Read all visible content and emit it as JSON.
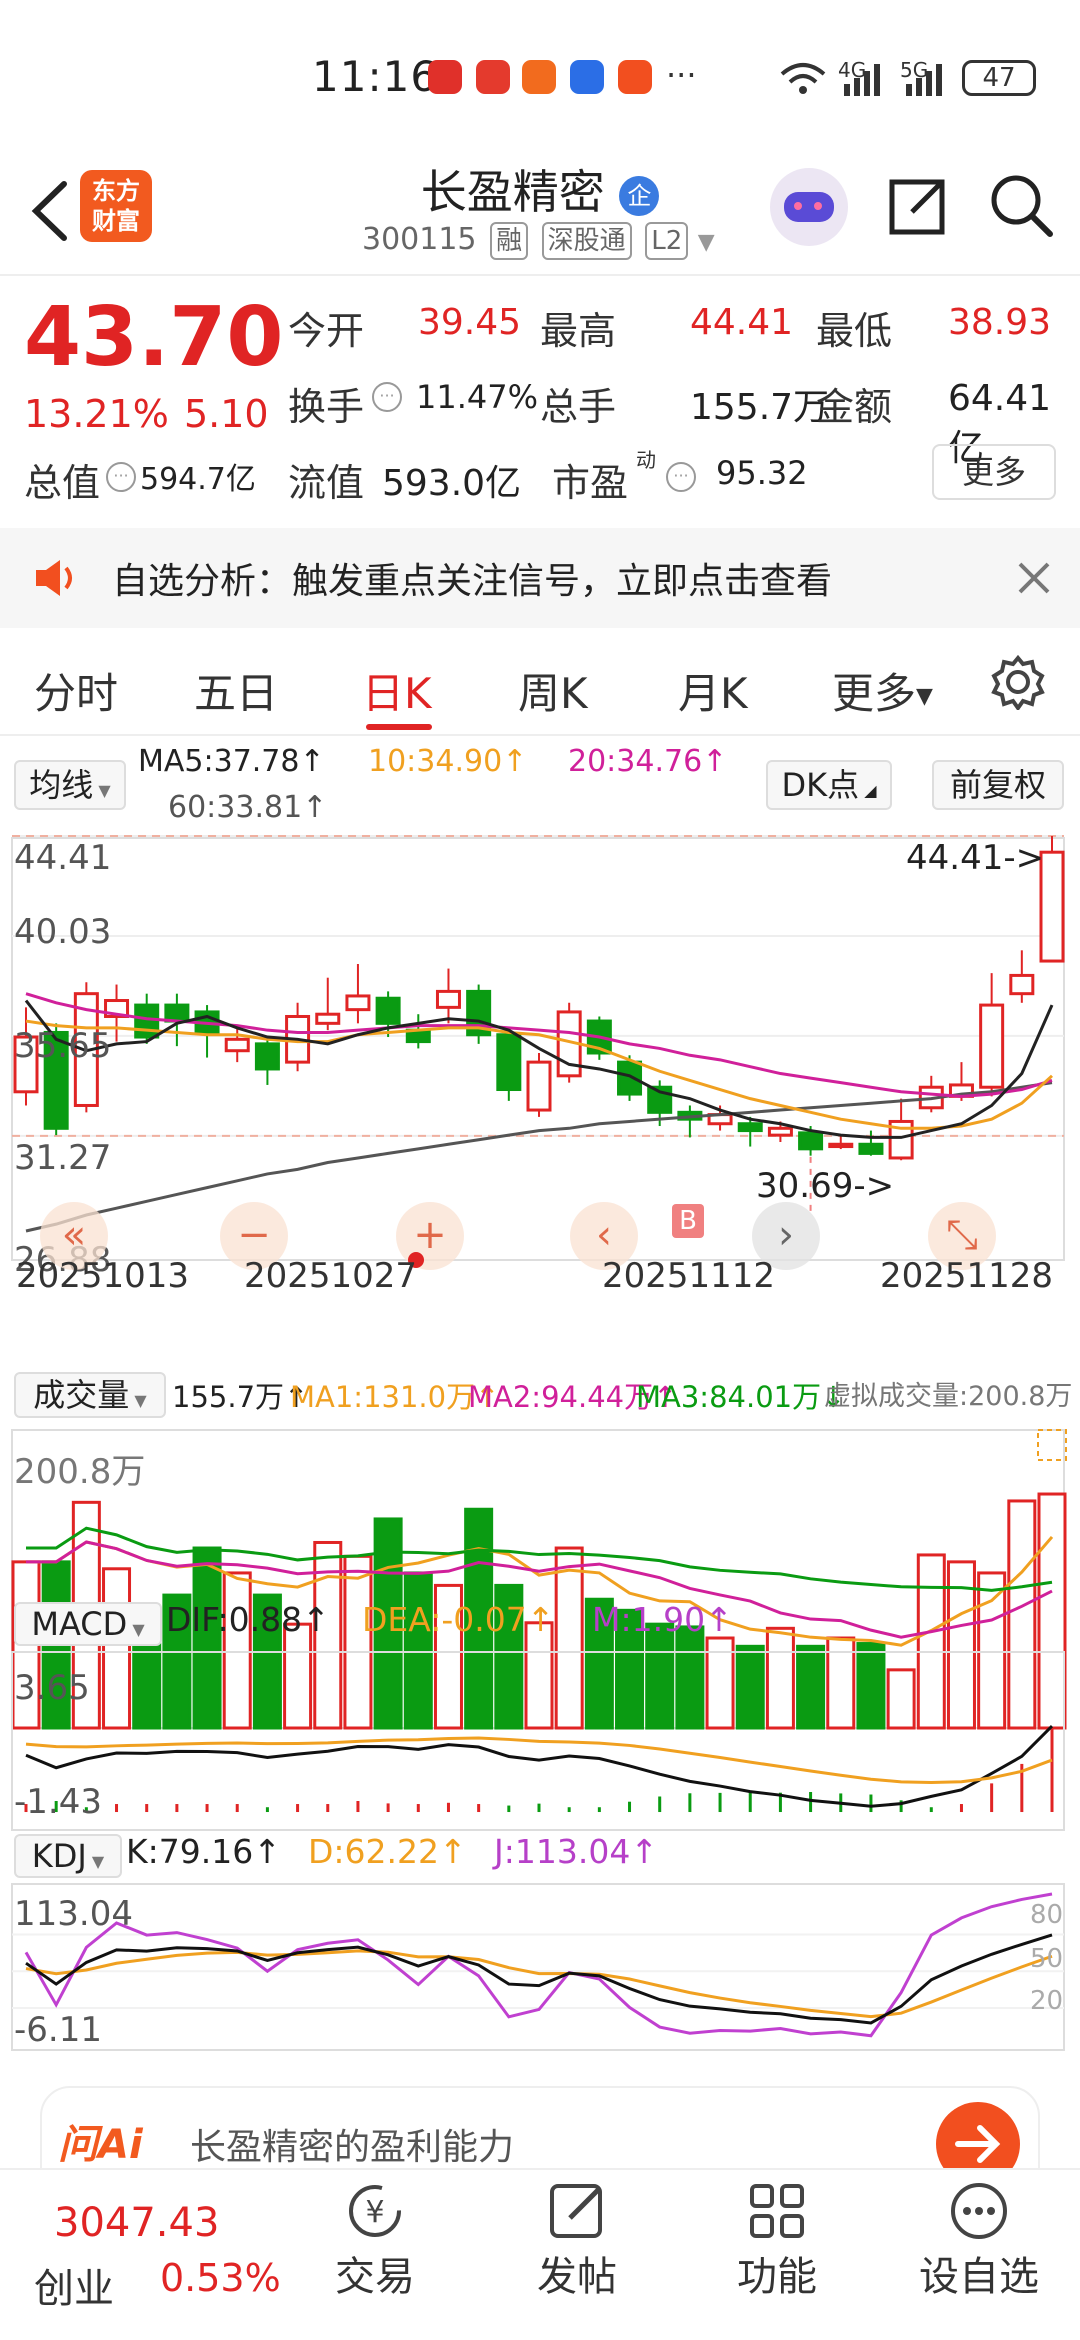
{
  "status_bar": {
    "time": "11:16",
    "battery": "47",
    "signal_a": "4G",
    "signal_b": "5G",
    "more": "···"
  },
  "header": {
    "logo_text": "东方\n财富",
    "title": "长盈精密",
    "title_badge": "企",
    "code": "300115",
    "tags": [
      "融",
      "深股通",
      "L2"
    ]
  },
  "quote": {
    "price": "43.70",
    "change_pct": "13.21%",
    "change": "5.10",
    "rows": [
      [
        {
          "label": "今开",
          "value": "39.45",
          "red": true
        },
        {
          "label": "最高",
          "value": "44.41",
          "red": true
        },
        {
          "label": "最低",
          "value": "38.93",
          "red": true
        }
      ],
      [
        {
          "label": "换手",
          "value": "11.47%",
          "red": false
        },
        {
          "label": "总手",
          "value": "155.7万",
          "red": false
        },
        {
          "label": "金额",
          "value": "64.41亿",
          "red": false
        }
      ],
      [
        {
          "label": "总值",
          "value": "594.7亿",
          "red": false
        },
        {
          "label": "流值",
          "value": "593.0亿",
          "red": false
        },
        {
          "label": "市盈",
          "value": "95.32",
          "red": false
        }
      ]
    ],
    "pe_sup": "动",
    "more_label": "更多"
  },
  "alert": {
    "text": "自选分析：触发重点关注信号，立即点击查看"
  },
  "tabs": [
    "分时",
    "五日",
    "日K",
    "周K",
    "月K",
    "更多"
  ],
  "active_tab": 2,
  "ma_bar": {
    "selector": "均线",
    "ma5": "MA5:37.78",
    "ma10": "10:34.90",
    "ma20": "20:34.76",
    "ma60": "60:33.81",
    "dk_label": "DK点",
    "adjust_label": "前复权"
  },
  "kline": {
    "y_labels": [
      "44.41",
      "40.03",
      "35.65",
      "31.27",
      "26.88"
    ],
    "high_marker": "44.41->",
    "low_marker": "30.69->",
    "buy_marker": "B",
    "dates": [
      "20251013",
      "20251027",
      "20251112",
      "20251128"
    ],
    "candles": [
      {
        "o": 33.2,
        "c": 35.6,
        "h": 36.9,
        "l": 32.6
      },
      {
        "o": 35.8,
        "c": 31.6,
        "h": 36.2,
        "l": 31.3
      },
      {
        "o": 32.6,
        "c": 37.5,
        "h": 38.0,
        "l": 32.3
      },
      {
        "o": 36.5,
        "c": 37.2,
        "h": 37.9,
        "l": 35.4
      },
      {
        "o": 37.0,
        "c": 35.6,
        "h": 37.5,
        "l": 35.3
      },
      {
        "o": 37.0,
        "c": 36.3,
        "h": 37.5,
        "l": 35.2
      },
      {
        "o": 36.7,
        "c": 35.8,
        "h": 37.0,
        "l": 34.7
      },
      {
        "o": 35.0,
        "c": 35.5,
        "h": 36.0,
        "l": 34.5
      },
      {
        "o": 35.3,
        "c": 34.2,
        "h": 35.6,
        "l": 33.5
      },
      {
        "o": 34.5,
        "c": 36.5,
        "h": 37.1,
        "l": 34.1
      },
      {
        "o": 36.2,
        "c": 36.6,
        "h": 38.2,
        "l": 35.9
      },
      {
        "o": 36.8,
        "c": 37.4,
        "h": 38.8,
        "l": 36.2
      },
      {
        "o": 37.3,
        "c": 36.2,
        "h": 37.6,
        "l": 35.6
      },
      {
        "o": 35.9,
        "c": 35.4,
        "h": 36.6,
        "l": 35.1
      },
      {
        "o": 36.9,
        "c": 37.6,
        "h": 38.6,
        "l": 36.2
      },
      {
        "o": 37.6,
        "c": 35.7,
        "h": 37.9,
        "l": 35.3
      },
      {
        "o": 35.7,
        "c": 33.3,
        "h": 36.0,
        "l": 32.8
      },
      {
        "o": 32.4,
        "c": 34.5,
        "h": 34.9,
        "l": 32.1
      },
      {
        "o": 33.9,
        "c": 36.7,
        "h": 37.1,
        "l": 33.6
      },
      {
        "o": 36.3,
        "c": 34.9,
        "h": 36.5,
        "l": 34.6
      },
      {
        "o": 34.5,
        "c": 33.1,
        "h": 34.8,
        "l": 32.8
      },
      {
        "o": 33.4,
        "c": 32.3,
        "h": 33.7,
        "l": 31.7
      },
      {
        "o": 32.3,
        "c": 32.0,
        "h": 32.6,
        "l": 31.2
      },
      {
        "o": 31.8,
        "c": 32.2,
        "h": 32.6,
        "l": 31.5
      },
      {
        "o": 31.8,
        "c": 31.5,
        "h": 32.1,
        "l": 30.8
      },
      {
        "o": 31.3,
        "c": 31.6,
        "h": 31.9,
        "l": 31.0
      },
      {
        "o": 31.4,
        "c": 30.7,
        "h": 31.7,
        "l": 30.4
      },
      {
        "o": 30.8,
        "c": 30.9,
        "h": 31.3,
        "l": 30.69
      },
      {
        "o": 30.9,
        "c": 30.5,
        "h": 31.5,
        "l": 30.4
      },
      {
        "o": 30.3,
        "c": 31.9,
        "h": 32.9,
        "l": 30.2
      },
      {
        "o": 32.5,
        "c": 33.4,
        "h": 33.9,
        "l": 32.3
      },
      {
        "o": 33.0,
        "c": 33.5,
        "h": 34.5,
        "l": 32.8
      },
      {
        "o": 33.4,
        "c": 37.0,
        "h": 38.4,
        "l": 33.0
      },
      {
        "o": 37.5,
        "c": 38.3,
        "h": 39.4,
        "l": 37.1
      },
      {
        "o": 38.93,
        "c": 43.7,
        "h": 44.41,
        "l": 38.93
      }
    ],
    "ma5": [
      37.2,
      35.5,
      35.0,
      35.3,
      35.4,
      36.2,
      36.5,
      36.0,
      35.6,
      35.5,
      35.3,
      35.7,
      36.0,
      36.2,
      36.4,
      36.3,
      35.9,
      35.1,
      34.4,
      34.2,
      33.9,
      33.2,
      32.9,
      32.4,
      32.0,
      31.8,
      31.5,
      31.3,
      31.2,
      31.2,
      31.5,
      31.8,
      32.6,
      34.0,
      37.0
    ],
    "ma10": [
      36.3,
      36.1,
      36.0,
      36.0,
      35.9,
      35.8,
      35.7,
      35.7,
      35.5,
      35.4,
      35.4,
      35.7,
      35.8,
      35.9,
      36.0,
      36.0,
      35.8,
      35.7,
      35.4,
      35.1,
      34.6,
      34.1,
      33.7,
      33.3,
      32.9,
      32.6,
      32.3,
      32.0,
      31.8,
      31.6,
      31.6,
      31.7,
      32.0,
      32.7,
      33.9
    ],
    "ma20": [
      37.5,
      37.1,
      36.8,
      36.6,
      36.4,
      36.3,
      36.2,
      36.1,
      35.9,
      35.8,
      35.8,
      35.9,
      36.0,
      36.1,
      36.1,
      36.1,
      36.0,
      35.9,
      35.8,
      35.6,
      35.3,
      35.1,
      34.8,
      34.6,
      34.3,
      34.0,
      33.8,
      33.6,
      33.4,
      33.2,
      33.1,
      33.0,
      33.1,
      33.3,
      33.7
    ],
    "ma60": [
      27.1,
      27.4,
      27.8,
      28.1,
      28.4,
      28.7,
      29.0,
      29.3,
      29.6,
      29.8,
      30.1,
      30.3,
      30.5,
      30.7,
      30.9,
      31.1,
      31.3,
      31.5,
      31.6,
      31.8,
      31.9,
      32.0,
      32.1,
      32.2,
      32.3,
      32.4,
      32.5,
      32.6,
      32.7,
      32.8,
      32.9,
      33.1,
      33.2,
      33.4,
      33.6
    ]
  },
  "volume": {
    "selector": "成交量",
    "value": "155.7万",
    "ma1": "MA1:131.0万",
    "ma2": "MA2:94.44万",
    "ma3": "MA3:84.01万",
    "virtual": "虚拟成交量:200.8万",
    "y_label": "200.8万",
    "bars": [
      120,
      120,
      163,
      115,
      87,
      96,
      130,
      112,
      96,
      75,
      134,
      124,
      151,
      112,
      103,
      158,
      103,
      76,
      130,
      93,
      85,
      75,
      73,
      65,
      59,
      72,
      59,
      65,
      61,
      42,
      125,
      120,
      112,
      164,
      169
    ]
  },
  "macd": {
    "selector": "MACD",
    "dif": "DIF:0.88",
    "dea": "DEA:-0.07",
    "m": "M:1.90",
    "y_labels": [
      "3.65",
      "-1.43"
    ]
  },
  "kdj": {
    "selector": "KDJ",
    "k": "K:79.16",
    "d": "D:62.22",
    "j": "J:113.04",
    "y_labels": [
      "113.04",
      "-6.11"
    ],
    "right_labels": [
      "80",
      "50",
      "20"
    ]
  },
  "ai_bar": {
    "brand": "问Ai",
    "prompt": "长盈精密的盈利能力"
  },
  "bottom_nav": {
    "index_value": "3047.43",
    "index_name": "创业",
    "index_change": "0.53%",
    "items": [
      "交易",
      "发帖",
      "功能",
      "设自选"
    ]
  },
  "colors": {
    "up": "#e02424",
    "down": "#0a9b12",
    "ma5": "#222222",
    "ma10": "#f0a020",
    "ma20": "#d0209a",
    "ma60": "#555555"
  }
}
